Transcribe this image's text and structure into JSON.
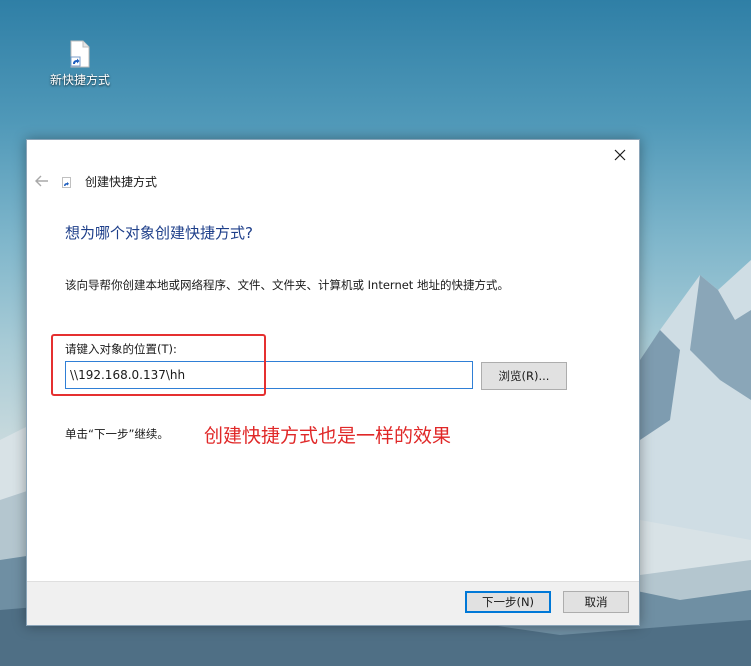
{
  "desktop": {
    "shortcut_icon_label": "新快捷方式"
  },
  "dialog": {
    "title": "创建快捷方式",
    "heading": "想为哪个对象创建快捷方式?",
    "description": "该向导帮你创建本地或网络程序、文件、文件夹、计算机或 Internet 地址的快捷方式。",
    "location_label": "请键入对象的位置(T):",
    "location_value": "\\\\192.168.0.137\\hh",
    "browse_button": "浏览(R)...",
    "hint": "单击“下一步”继续。",
    "next_button": "下一步(N)",
    "cancel_button": "取消"
  },
  "annotation": {
    "text": "创建快捷方式也是一样的效果",
    "color": "#e02828"
  },
  "icons": [
    "shortcut-file-icon",
    "close-icon",
    "back-arrow-icon",
    "shortcut-small-icon"
  ]
}
